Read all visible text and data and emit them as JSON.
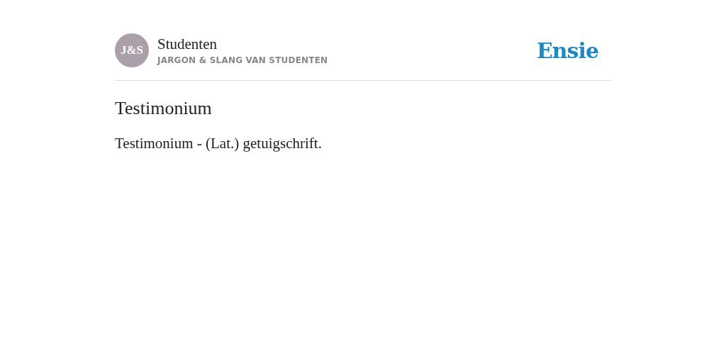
{
  "source": {
    "avatar": "J&S",
    "title": "Studenten",
    "subtitle": "JARGON & SLANG VAN STUDENTEN"
  },
  "logo": "Ensie",
  "entry": {
    "heading": "Testimonium",
    "definition": "Testimonium - (Lat.) getuigschrift."
  }
}
